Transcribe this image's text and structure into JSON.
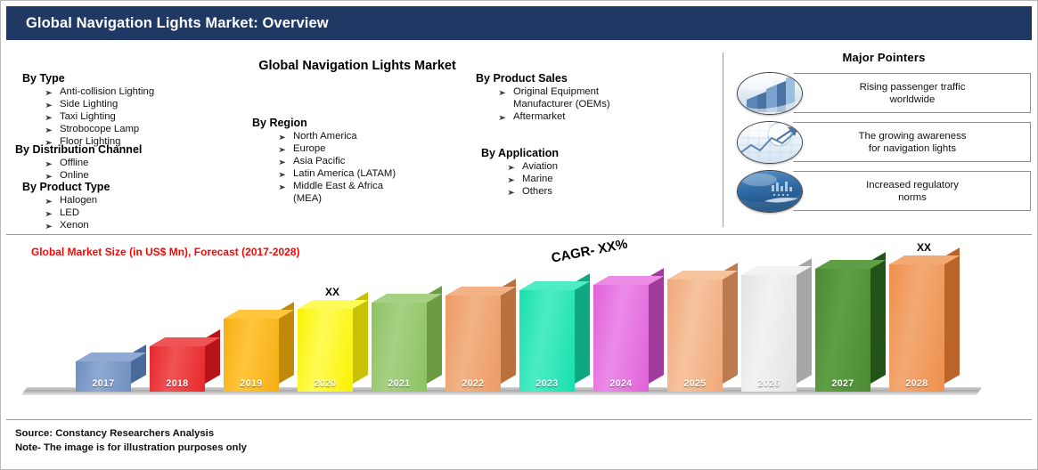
{
  "header": {
    "title": "Global Navigation Lights Market: Overview"
  },
  "segments": {
    "by_type": {
      "heading": "By Type",
      "items": [
        "Anti-collision Lighting",
        "Side Lighting",
        "Taxi Lighting",
        "Strobocope Lamp",
        "Floor Lighting"
      ]
    },
    "by_distribution_channel": {
      "heading": "By Distribution Channel",
      "items": [
        "Offline",
        "Online"
      ]
    },
    "by_product_type": {
      "heading": "By Product Type",
      "items": [
        "Halogen",
        "LED",
        "Xenon"
      ]
    },
    "center_title": "Global Navigation Lights Market",
    "by_region": {
      "heading": "By Region",
      "items": [
        "North America",
        "Europe",
        "Asia Pacific",
        "Latin America (LATAM)",
        "Middle East & Africa\n(MEA)"
      ]
    },
    "by_product_sales": {
      "heading": "By Product Sales",
      "items": [
        "Original Equipment\nManufacturer (OEMs)",
        "Aftermarket"
      ]
    },
    "by_application": {
      "heading": "By Application",
      "items": [
        "Aviation",
        "Marine",
        "Others"
      ]
    }
  },
  "major_pointers": {
    "title": "Major Pointers",
    "items": [
      {
        "icon": "bar-chart-icon",
        "text": "Rising passenger traffic\nworldwide"
      },
      {
        "icon": "line-chart-icon",
        "text": "The growing awareness\nfor navigation lights"
      },
      {
        "icon": "globe-icon",
        "text": "Increased regulatory\nnorms"
      }
    ]
  },
  "chart_data": {
    "type": "bar",
    "title": "Global Market Size (in US$ Mn), Forecast (2017-2028)",
    "title_color": "#FF0000",
    "annotation": "CAGR- XX%",
    "xlabel": "",
    "ylabel": "",
    "grid": false,
    "legend": "none",
    "value_labels": [
      "",
      "",
      "",
      "XX",
      "",
      "",
      "",
      "",
      "",
      "",
      "",
      "XX"
    ],
    "categories": [
      "2017",
      "2018",
      "2019",
      "2020",
      "2021",
      "2022",
      "2023",
      "2024",
      "2025",
      "2026",
      "2027",
      "2028"
    ],
    "values": [
      41,
      62,
      100,
      113,
      122,
      131,
      139,
      146,
      153,
      159,
      168,
      174
    ],
    "ylim": [
      0,
      185
    ],
    "colors": [
      "#6E8FC0",
      "#E8282B",
      "#F5AF12",
      "#FAF200",
      "#8CC262",
      "#ED9B63",
      "#17E0AD",
      "#E061DA",
      "#F0A878",
      "#E3E3E3",
      "#4C8A34",
      "#EF8F4B"
    ],
    "side_colors": [
      "#4A6A9C",
      "#B81418",
      "#C08908",
      "#C8C104",
      "#6B9C41",
      "#B9713F",
      "#0FA883",
      "#A03A9B",
      "#BB7B4F",
      "#A6A6A6",
      "#23521A",
      "#B9652A"
    ],
    "top_colors": [
      "#8FA9D2",
      "#F05355",
      "#FFC53C",
      "#FFFB56",
      "#A7D083",
      "#F2B286",
      "#4DECC3",
      "#EB8BE6",
      "#F6C39F",
      "#F2F2F2",
      "#5E9E44",
      "#F3A974"
    ]
  },
  "footer": {
    "source": "Source: Constancy Researchers Analysis",
    "note": "Note- The image is for illustration purposes only"
  }
}
